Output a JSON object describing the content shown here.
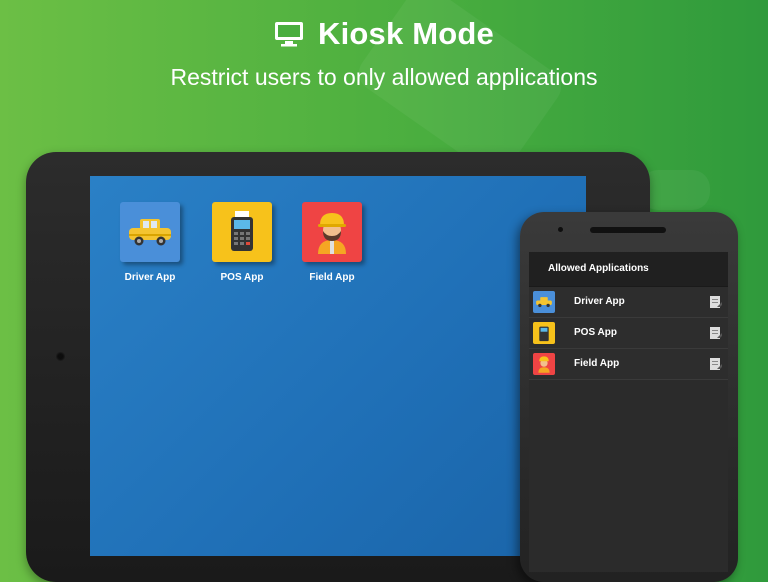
{
  "header": {
    "icon": "monitor-icon",
    "title": "Kiosk Mode",
    "subtitle": "Restrict users to only allowed applications"
  },
  "tablet": {
    "apps": [
      {
        "label": "Driver App",
        "icon": "taxi-icon",
        "color": "#4a8fd9"
      },
      {
        "label": "POS App",
        "icon": "pos-terminal-icon",
        "color": "#f7c21b"
      },
      {
        "label": "Field App",
        "icon": "worker-icon",
        "color": "#ef4444"
      }
    ]
  },
  "phone": {
    "header": "Allowed Applications",
    "items": [
      {
        "label": "Driver App",
        "icon": "taxi-icon",
        "color": "#4a8fd9",
        "action_icon": "edit-icon"
      },
      {
        "label": "POS App",
        "icon": "pos-terminal-icon",
        "color": "#f7c21b",
        "action_icon": "edit-icon"
      },
      {
        "label": "Field App",
        "icon": "worker-icon",
        "color": "#ef4444",
        "action_icon": "edit-icon"
      }
    ]
  },
  "colors": {
    "background_start": "#6cbf45",
    "background_end": "#2f9a3c",
    "tablet_screen": "#2176bd"
  }
}
